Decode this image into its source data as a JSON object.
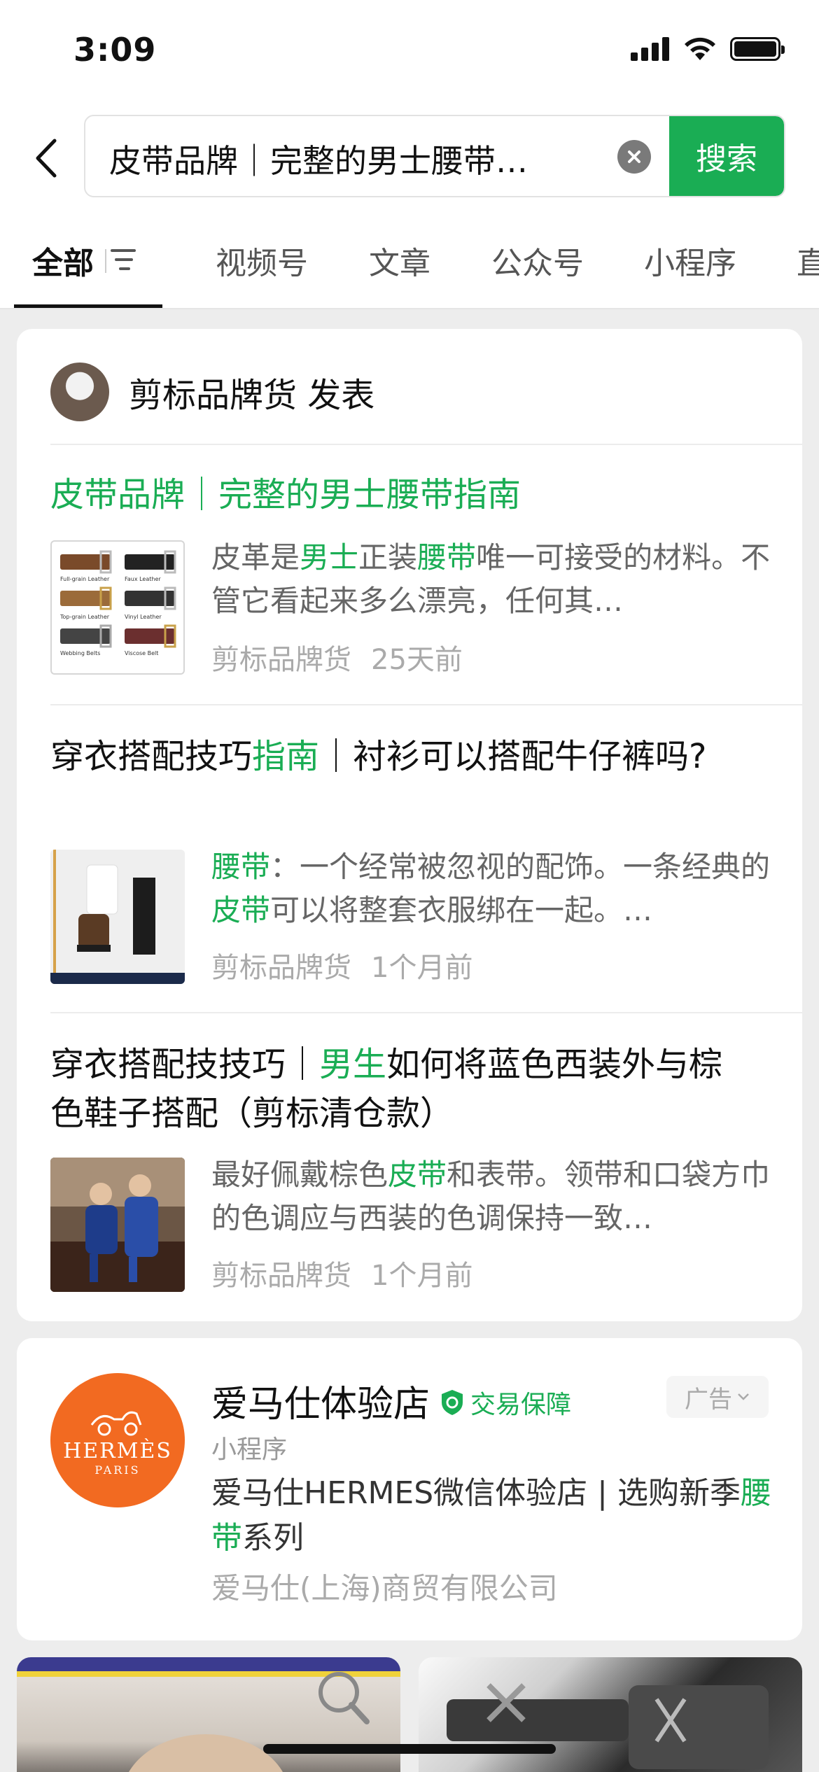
{
  "status_bar": {
    "time": "3:09"
  },
  "search": {
    "query": "皮带品牌｜完整的男士腰带…",
    "button_label": "搜索"
  },
  "tabs": [
    {
      "label": "全部",
      "active": true
    },
    {
      "label": "视频号"
    },
    {
      "label": "文章"
    },
    {
      "label": "公众号"
    },
    {
      "label": "小程序"
    },
    {
      "label": "直"
    }
  ],
  "author": {
    "name": "剪标品牌货 发表"
  },
  "articles": [
    {
      "title_parts": [
        {
          "text": "皮带品牌｜完整的男士腰带指南",
          "hl": true
        }
      ],
      "excerpt_parts": [
        {
          "text": "皮革是",
          "hl": false
        },
        {
          "text": "男士",
          "hl": true
        },
        {
          "text": "正装",
          "hl": false
        },
        {
          "text": "腰带",
          "hl": true
        },
        {
          "text": "唯一可接受的材料。不管它看起来多么漂亮，任何其…",
          "hl": false
        }
      ],
      "source": "剪标品牌货",
      "time": "25天前",
      "thumb_labels": [
        "Full-grain Leather",
        "Faux Leather",
        "Top-grain Leather",
        "Vinyl Leather",
        "Webbing Belts",
        "Viscose Belt"
      ]
    },
    {
      "title_parts": [
        {
          "text": "穿衣搭配技巧",
          "hl": false
        },
        {
          "text": "指南",
          "hl": true
        },
        {
          "text": "｜衬衫可以搭配牛仔裤吗?",
          "hl": false
        }
      ],
      "excerpt_parts": [
        {
          "text": "腰带",
          "hl": true
        },
        {
          "text": "：一个经常被忽视的配饰。一条经典的",
          "hl": false
        },
        {
          "text": "皮带",
          "hl": true
        },
        {
          "text": "可以将整套衣服绑在一起。…",
          "hl": false
        }
      ],
      "source": "剪标品牌货",
      "time": "1个月前"
    },
    {
      "title_parts": [
        {
          "text": "穿衣搭配技技巧｜",
          "hl": false
        },
        {
          "text": "男生",
          "hl": true
        },
        {
          "text": "如何将蓝色西装外与棕色鞋子搭配（剪标清仓款）",
          "hl": false
        }
      ],
      "excerpt_parts": [
        {
          "text": "最好佩戴棕色",
          "hl": false
        },
        {
          "text": "皮带",
          "hl": true
        },
        {
          "text": "和表带。领带和口袋方巾的色调应与西装的色调保持一致…",
          "hl": false
        }
      ],
      "source": "剪标品牌货",
      "time": "1个月前"
    }
  ],
  "mini_program": {
    "name": "爱马仕体验店",
    "guarantee": "交易保障",
    "ad_label": "广告",
    "type": "小程序",
    "desc_parts": [
      {
        "text": "爱马仕HERMES微信体验店 | 选购新季",
        "hl": false
      },
      {
        "text": "腰带",
        "hl": true
      },
      {
        "text": "系列",
        "hl": false
      }
    ],
    "company": "爱马仕(上海)商贸有限公司",
    "logo_brand": "HERMÈS",
    "logo_city": "PARIS"
  },
  "colors": {
    "accent": "#1aad54",
    "hermes_orange": "#f26a21"
  }
}
